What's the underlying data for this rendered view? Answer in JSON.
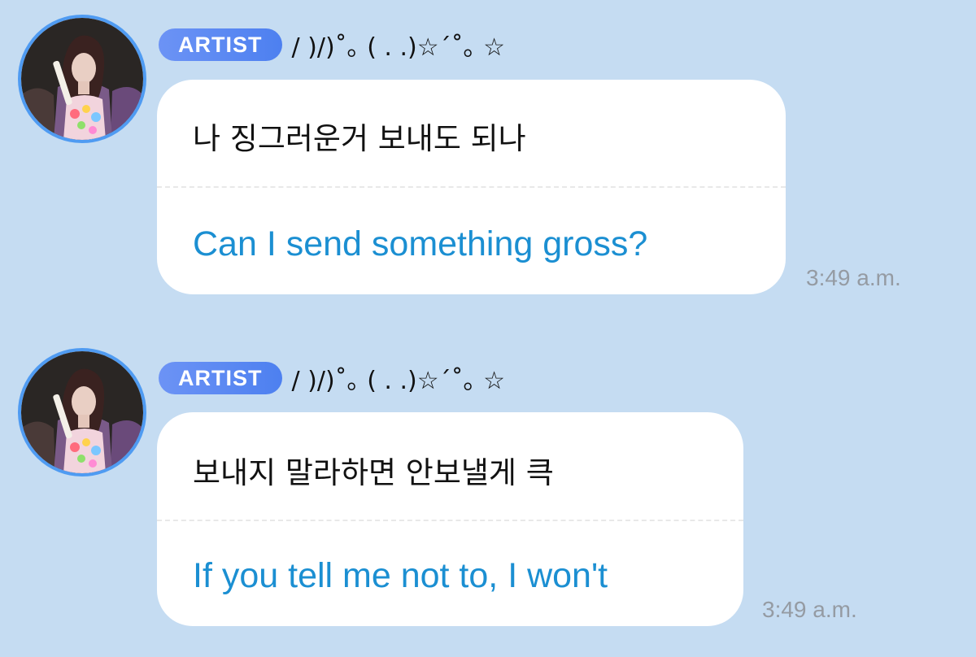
{
  "messages": [
    {
      "badge": "ARTIST",
      "nickname": "/ )/)˚｡ ( . .)☆´˚｡ ☆",
      "original": "나 징그러운거 보내도 되나",
      "translation": "Can I send something gross?",
      "time": "3:49 a.m."
    },
    {
      "badge": "ARTIST",
      "nickname": "/ )/)˚｡ ( . .)☆´˚｡ ☆",
      "original": "보내지 말라하면 안보낼게 큭",
      "translation": "If you tell me not to, I won't",
      "time": "3:49 a.m."
    }
  ],
  "colors": {
    "background": "#c5dcf2",
    "bubble": "#ffffff",
    "badge": "#5b87f2",
    "avatar_ring": "#4f9bf2",
    "translation_text": "#1b8fd2",
    "timestamp": "#959ba3"
  }
}
